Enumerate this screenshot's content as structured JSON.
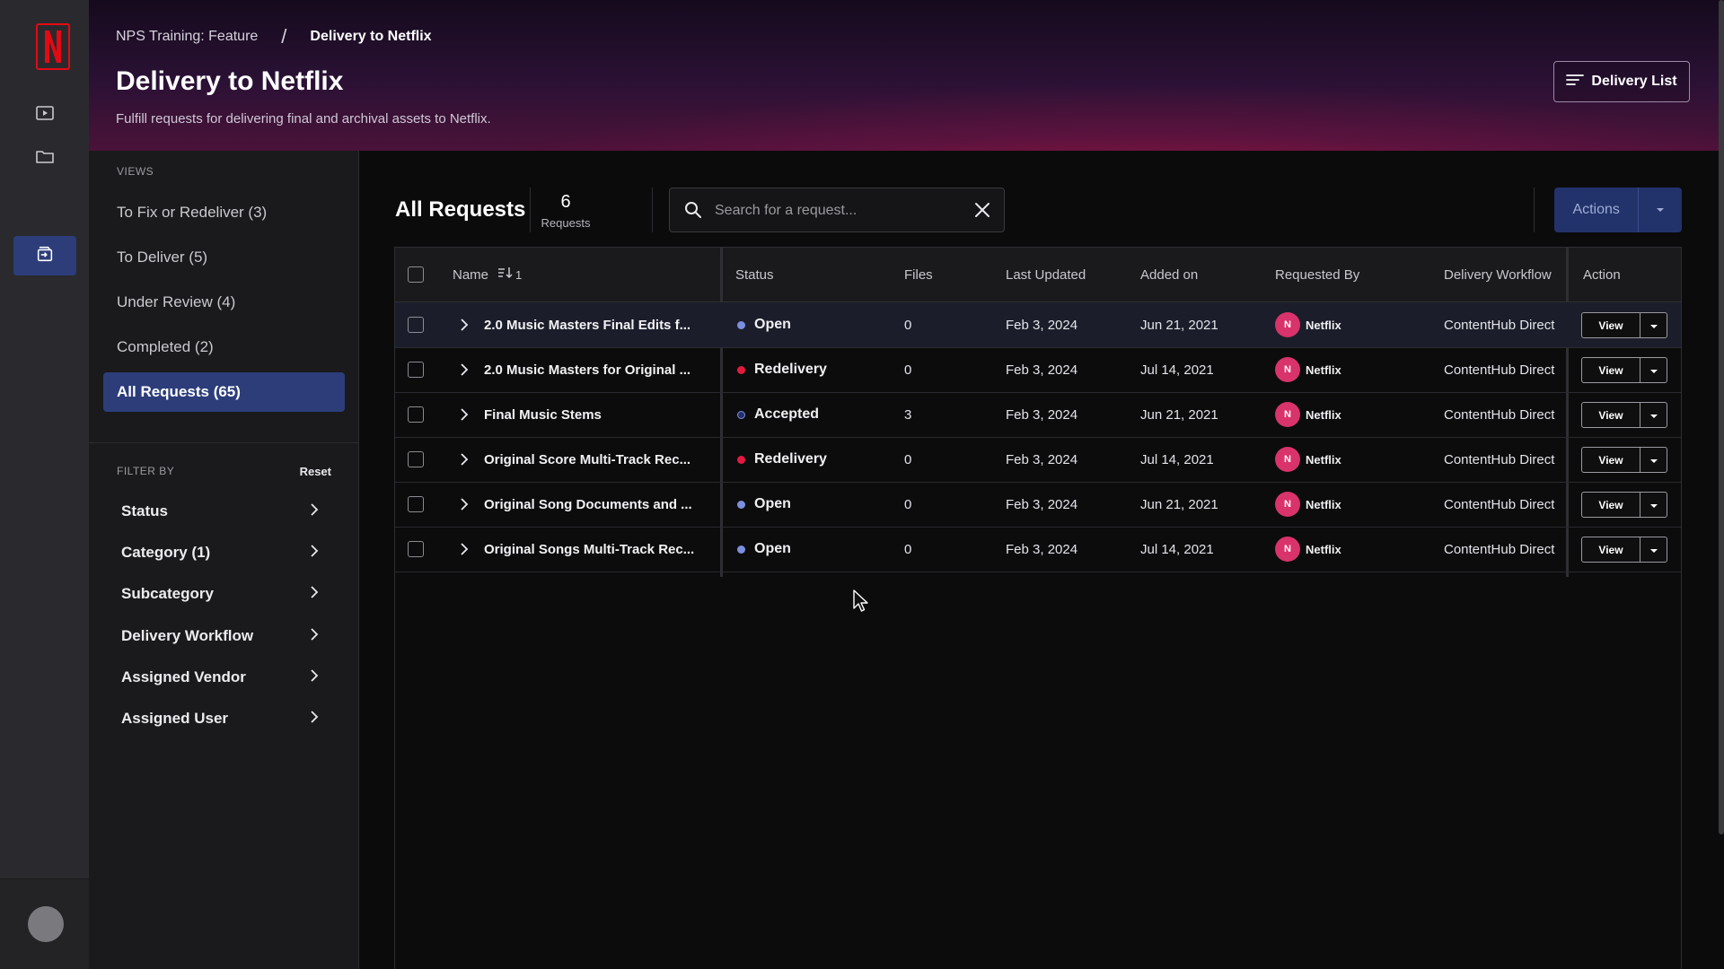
{
  "header": {
    "breadcrumb": [
      "NPS Training: Feature",
      "Delivery to Netflix"
    ],
    "title": "Delivery to Netflix",
    "subtitle": "Fulfill requests for delivering final and archival assets to Netflix.",
    "delivery_list_label": "Delivery List"
  },
  "views": {
    "section_label": "VIEWS",
    "items": [
      {
        "label": "To Fix or Redeliver (3)"
      },
      {
        "label": "To Deliver (5)"
      },
      {
        "label": "Under Review (4)"
      },
      {
        "label": "Completed (2)"
      },
      {
        "label": "All Requests (65)"
      }
    ]
  },
  "filters": {
    "section_label": "FILTER BY",
    "reset_label": "Reset",
    "items": [
      {
        "label": "Status"
      },
      {
        "label": "Category (1)"
      },
      {
        "label": "Subcategory"
      },
      {
        "label": "Delivery Workflow"
      },
      {
        "label": "Assigned Vendor"
      },
      {
        "label": "Assigned User"
      }
    ]
  },
  "main": {
    "title": "All Requests",
    "count": "6",
    "count_label": "Requests",
    "search_placeholder": "Search for a request...",
    "actions_label": "Actions"
  },
  "table": {
    "headers": {
      "name": "Name",
      "sort": "1",
      "status": "Status",
      "files": "Files",
      "last_updated": "Last Updated",
      "added_on": "Added on",
      "requested_by": "Requested By",
      "delivery_workflow": "Delivery Workflow",
      "action": "Action"
    },
    "rows": [
      {
        "name": "2.0 Music Masters Final Edits f...",
        "status": "Open",
        "status_color": "#7b8fe0",
        "files": "0",
        "last_updated": "Feb 3, 2024",
        "added_on": "Jun 21, 2021",
        "requester_initial": "N",
        "requester": "Netflix",
        "workflow": "ContentHub Direct",
        "action": "View"
      },
      {
        "name": "2.0 Music Masters for Original ...",
        "status": "Redelivery",
        "status_color": "#e5193f",
        "files": "0",
        "last_updated": "Feb 3, 2024",
        "added_on": "Jul 14, 2021",
        "requester_initial": "N",
        "requester": "Netflix",
        "workflow": "ContentHub Direct",
        "action": "View"
      },
      {
        "name": "Final Music Stems",
        "status": "Accepted",
        "status_color": "#23306a",
        "files": "3",
        "last_updated": "Feb 3, 2024",
        "added_on": "Jun 21, 2021",
        "requester_initial": "N",
        "requester": "Netflix",
        "workflow": "ContentHub Direct",
        "action": "View"
      },
      {
        "name": "Original Score Multi-Track Rec...",
        "status": "Redelivery",
        "status_color": "#e5193f",
        "files": "0",
        "last_updated": "Feb 3, 2024",
        "added_on": "Jul 14, 2021",
        "requester_initial": "N",
        "requester": "Netflix",
        "workflow": "ContentHub Direct",
        "action": "View"
      },
      {
        "name": "Original Song Documents and ...",
        "status": "Open",
        "status_color": "#7b8fe0",
        "files": "0",
        "last_updated": "Feb 3, 2024",
        "added_on": "Jun 21, 2021",
        "requester_initial": "N",
        "requester": "Netflix",
        "workflow": "ContentHub Direct",
        "action": "View"
      },
      {
        "name": "Original Songs Multi-Track Rec...",
        "status": "Open",
        "status_color": "#7b8fe0",
        "files": "0",
        "last_updated": "Feb 3, 2024",
        "added_on": "Jul 14, 2021",
        "requester_initial": "N",
        "requester": "Netflix",
        "workflow": "ContentHub Direct",
        "action": "View"
      }
    ]
  },
  "colors": {
    "accent": "#2c3d7a",
    "brand": "#e50914",
    "avatar": "#d9336b"
  },
  "icons": {
    "rail": [
      "netflix-logo-icon",
      "play-icon",
      "folder-icon",
      "delivery-icon"
    ],
    "search": "search-icon",
    "clear": "close-icon"
  }
}
